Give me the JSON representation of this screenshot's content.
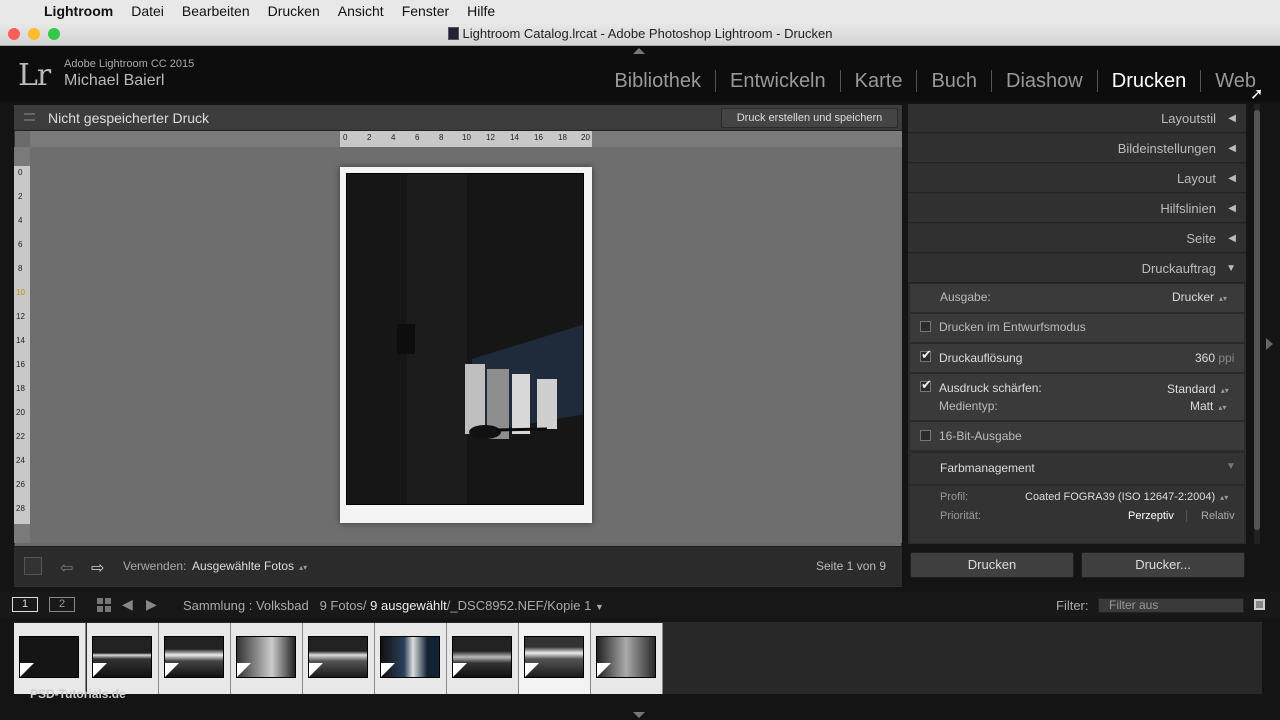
{
  "menubar": {
    "app": "Lightroom",
    "items": [
      "Datei",
      "Bearbeiten",
      "Drucken",
      "Ansicht",
      "Fenster",
      "Hilfe"
    ]
  },
  "window": {
    "title": "Lightroom Catalog.lrcat - Adobe Photoshop Lightroom - Drucken"
  },
  "identity": {
    "logo": "Lr",
    "version": "Adobe Lightroom CC 2015",
    "user": "Michael Baierl"
  },
  "modules": [
    {
      "label": "Bibliothek",
      "active": false
    },
    {
      "label": "Entwickeln",
      "active": false
    },
    {
      "label": "Karte",
      "active": false
    },
    {
      "label": "Buch",
      "active": false
    },
    {
      "label": "Diashow",
      "active": false
    },
    {
      "label": "Drucken",
      "active": true
    },
    {
      "label": "Web",
      "active": false
    }
  ],
  "center": {
    "title": "Nicht gespeicherter Druck",
    "save_button": "Druck erstellen und speichern",
    "ruler_top": [
      "0",
      "2",
      "4",
      "6",
      "8",
      "10",
      "12",
      "14",
      "16",
      "18",
      "20"
    ],
    "ruler_left": [
      "0",
      "2",
      "4",
      "6",
      "8",
      "10",
      "12",
      "14",
      "16",
      "18",
      "20",
      "22",
      "24",
      "26",
      "28"
    ]
  },
  "toolbar": {
    "use_label": "Verwenden:",
    "use_value": "Ausgewählte Fotos",
    "page_info": "Seite 1 von 9"
  },
  "right_panel": {
    "sections": [
      "Layoutstil",
      "Bildeinstellungen",
      "Layout",
      "Hilfslinien",
      "Seite",
      "Druckauftrag"
    ],
    "print_job": {
      "output_label": "Ausgabe:",
      "output_value": "Drucker",
      "draft_mode": "Drucken im Entwurfsmodus",
      "resolution_label": "Druckauflösung",
      "resolution_value": "360",
      "resolution_unit": "ppi",
      "sharpen_label": "Ausdruck schärfen:",
      "sharpen_value": "Standard",
      "media_label": "Medientyp:",
      "media_value": "Matt",
      "bit16": "16-Bit-Ausgabe",
      "color_mgmt": "Farbmanagement",
      "profile_label": "Profil:",
      "profile_value": "Coated FOGRA39 (ISO 12647-2:2004)",
      "priority_label": "Priorität:",
      "priority_perceptual": "Perzeptiv",
      "priority_relative": "Relativ"
    },
    "print_button": "Drucken",
    "printer_button": "Drucker..."
  },
  "filmstrip_bar": {
    "screen1": "1",
    "screen2": "2",
    "source": "Sammlung : Volksbad",
    "count": "9 Fotos/",
    "selected": "9 ausgewählt",
    "file": "/_DSC8952.NEF/Kopie 1",
    "filter_label": "Filter:",
    "filter_value": "Filter aus"
  },
  "watermark": "PSD-Tutorials.de"
}
